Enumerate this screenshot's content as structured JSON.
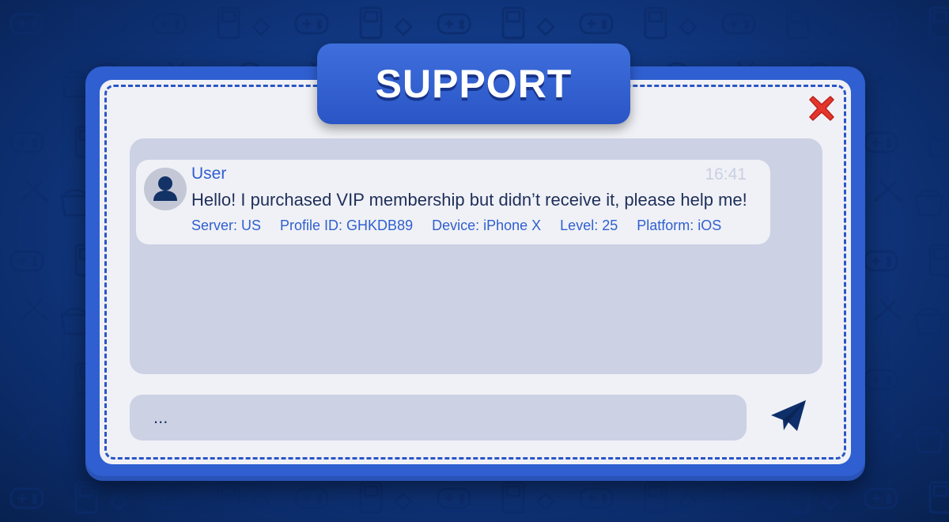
{
  "support_window": {
    "title": "SUPPORT",
    "close_icon": "close-x-icon",
    "message": {
      "avatar_icon": "user-silhouette-icon",
      "user": "User",
      "time": "16:41",
      "text": "Hello! I purchased VIP membership but didn’t receive it, please help me!",
      "meta": {
        "server": "Server: US",
        "profile_id": "Profile ID: GHKDB89",
        "device": "Device: iPhone X",
        "level": "Level: 25",
        "platform": "Platform: iOS"
      }
    },
    "input": {
      "value": "",
      "placeholder": "..."
    },
    "send_icon": "paper-plane-send-icon"
  },
  "colors": {
    "background": "#123a86",
    "panel": "#2f5fd0",
    "panel_inner": "#f0f1f6",
    "chat_area": "#ccd1e4",
    "accent_text": "#2f5fd0",
    "body_text": "#1e2f5a",
    "close_red": "#e5352b",
    "send_icon": "#0f2f6b"
  }
}
